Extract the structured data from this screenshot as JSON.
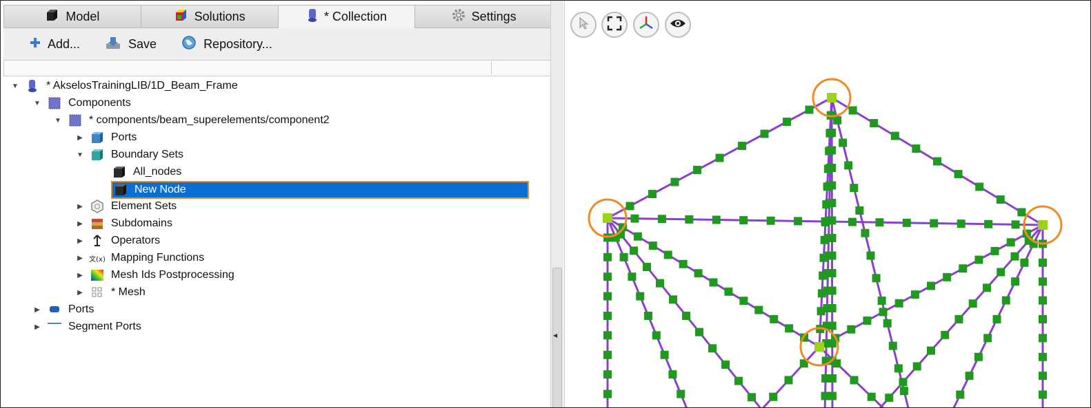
{
  "tabs": [
    {
      "label": "Model",
      "icon": "cube-icon"
    },
    {
      "label": "Solutions",
      "icon": "colored-cube-icon"
    },
    {
      "label": "* Collection",
      "icon": "database-icon"
    },
    {
      "label": "Settings",
      "icon": "gear-icon"
    }
  ],
  "toolbar": {
    "add_label": "Add...",
    "save_label": "Save",
    "repository_label": "Repository..."
  },
  "tree": {
    "root": "* AkselosTrainingLIB/1D_Beam_Frame",
    "components": "Components",
    "component2": "* components/beam_superelements/component2",
    "ports": "Ports",
    "boundary_sets": "Boundary Sets",
    "all_nodes": "All_nodes",
    "new_node": "New Node",
    "element_sets": "Element Sets",
    "subdomains": "Subdomains",
    "operators": "Operators",
    "mapping_functions": "Mapping Functions",
    "mesh_ids_postprocessing": "Mesh Ids Postprocessing",
    "mesh": "* Mesh",
    "top_ports": "Ports",
    "segment_ports": "Segment Ports",
    "mapping_icon_text": "文(x)"
  },
  "viewer": {
    "buttons": [
      "select-arrow-icon",
      "fit-view-icon",
      "axes-icon",
      "eye-icon"
    ],
    "beam_color": "#8a3fd1",
    "node_color": "#1f9a1f",
    "boundary_node_color": "#9bd31a",
    "highlight_color": "#f08a24"
  },
  "colors": {
    "selection": "#0a6fd3",
    "selection_outline": "#f08a24"
  }
}
